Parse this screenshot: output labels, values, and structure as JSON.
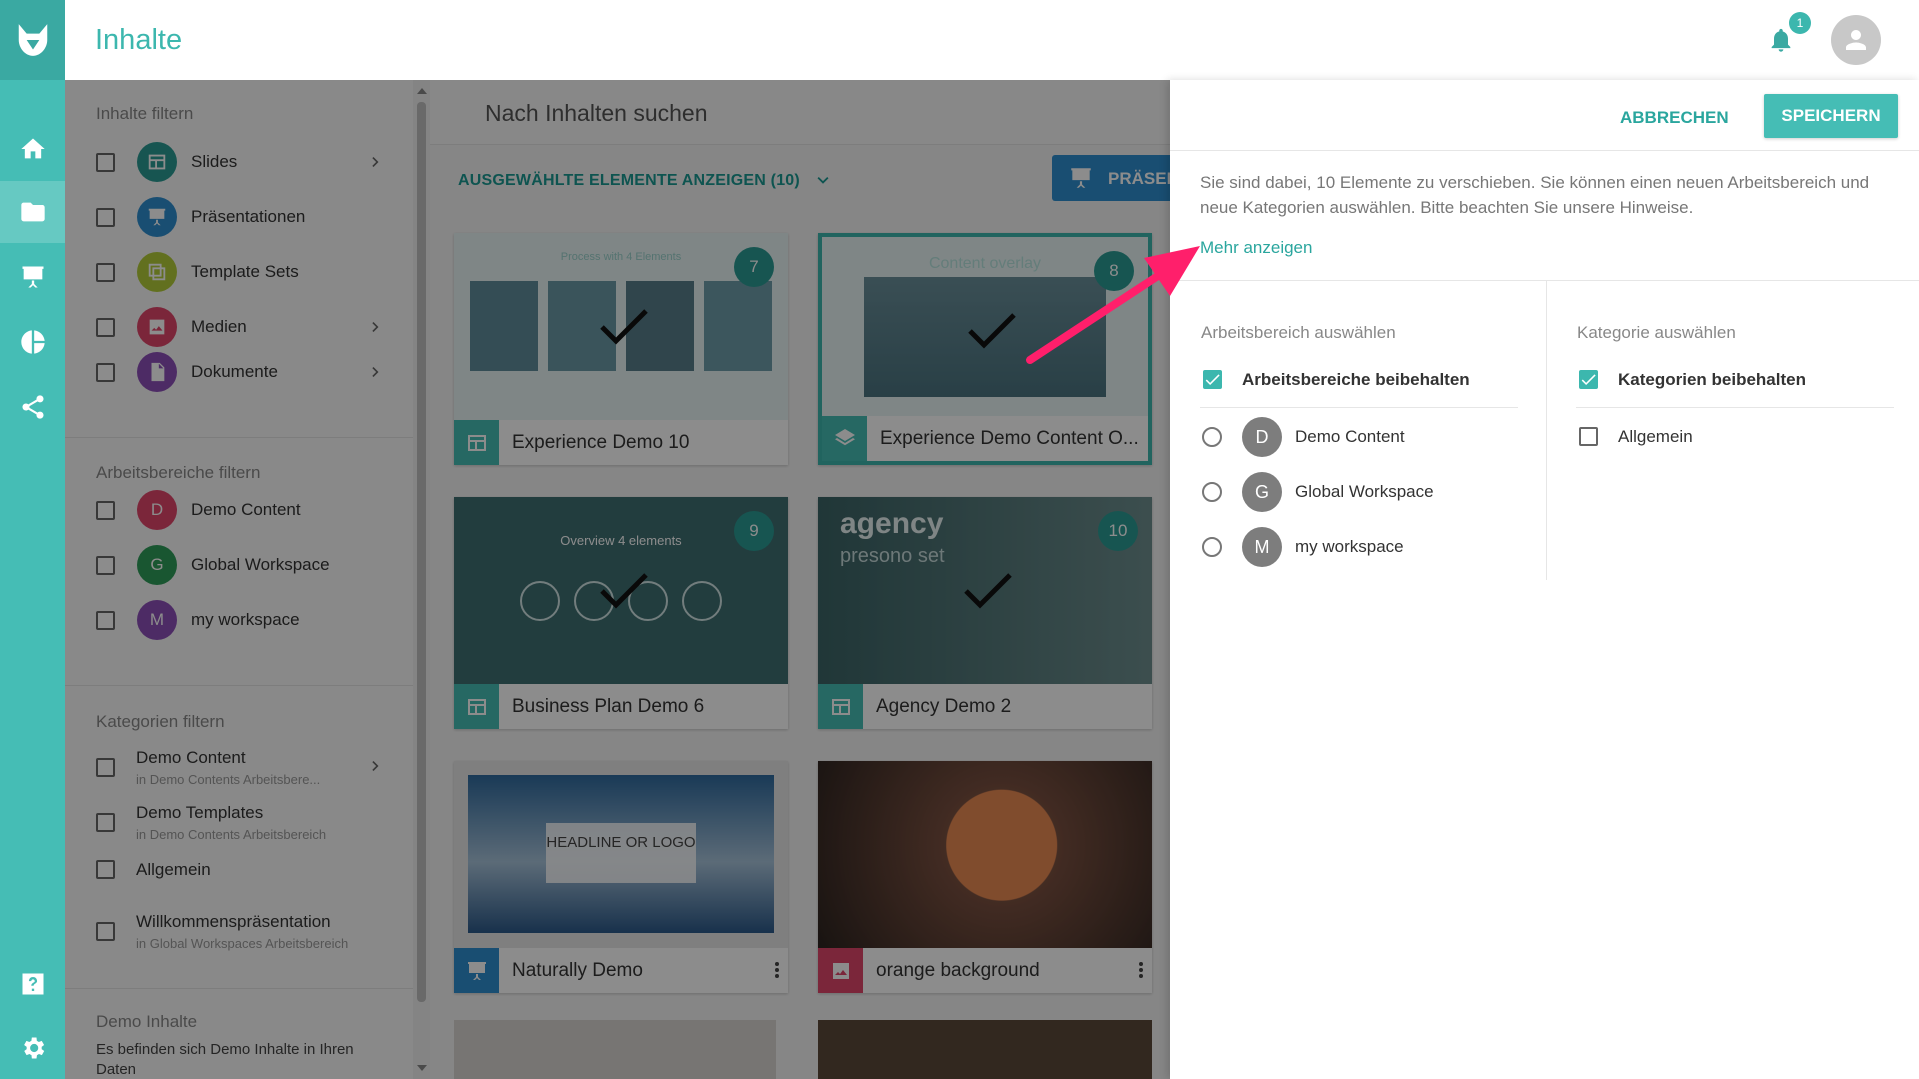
{
  "header": {
    "title": "Inhalte",
    "notification_count": "1"
  },
  "rail": {
    "items": [
      "home-icon",
      "folder-icon",
      "presentation-icon",
      "pie-chart-icon",
      "share-icon",
      "help-icon",
      "gear-icon"
    ]
  },
  "filters": {
    "content_title": "Inhalte filtern",
    "content_items": [
      {
        "label": "Slides",
        "color": "#2b9c94",
        "has_chevron": true
      },
      {
        "label": "Präsentationen",
        "color": "#2f8fd0",
        "has_chevron": false
      },
      {
        "label": "Template Sets",
        "color": "#b3cd3a",
        "has_chevron": false
      },
      {
        "label": "Medien",
        "color": "#e0466b",
        "has_chevron": true
      },
      {
        "label": "Dokumente",
        "color": "#8c4fb8",
        "has_chevron": true
      }
    ],
    "workspace_title": "Arbeitsbereiche filtern",
    "workspace_items": [
      {
        "letter": "D",
        "label": "Demo Content",
        "color": "#e0466b"
      },
      {
        "letter": "G",
        "label": "Global Workspace",
        "color": "#2f9d59"
      },
      {
        "letter": "M",
        "label": "my workspace",
        "color": "#8c4fb8"
      }
    ],
    "category_title": "Kategorien filtern",
    "category_items": [
      {
        "label": "Demo Content",
        "sub": "in Demo Contents Arbeitsbere...",
        "has_chevron": true
      },
      {
        "label": "Demo Templates",
        "sub": "in Demo Contents Arbeitsbereich",
        "has_chevron": false
      },
      {
        "label": "Allgemein",
        "sub": "",
        "has_chevron": false
      },
      {
        "label": "Willkommenspräsentation",
        "sub": "in Global Workspaces Arbeitsbereich",
        "has_chevron": false
      }
    ],
    "demo_title": "Demo Inhalte",
    "demo_text": "Es befinden sich Demo Inhalte in Ihren Daten"
  },
  "content": {
    "search_placeholder": "Nach Inhalten suchen",
    "show_selected": "AUSGEWÄHLTE ELEMENTE ANZEIGEN (10)",
    "present_label": "PRÄSEN",
    "cards": [
      {
        "name": "Experience Demo 10",
        "num": "7",
        "icon": "slide-icon",
        "thumb_text": "Process with 4 Elements",
        "selected": false
      },
      {
        "name": "Experience Demo Content O...",
        "num": "8",
        "icon": "layers-icon",
        "thumb_text": "Content overlay",
        "selected": true
      },
      {
        "name": "Business Plan Demo 6",
        "num": "9",
        "icon": "slide-icon",
        "thumb_text": "Overview 4 elements",
        "selected": false
      },
      {
        "name": "Agency Demo 2",
        "num": "10",
        "icon": "slide-icon",
        "thumb_text": "agency",
        "thumb_sub": "presono set",
        "selected": false
      },
      {
        "name": "Naturally Demo",
        "num": "",
        "icon": "presentation-icon",
        "thumb_text": "HEADLINE OR LOGO",
        "selected": false
      },
      {
        "name": "orange background",
        "num": "",
        "icon": "image-icon",
        "thumb_text": "",
        "selected": false
      }
    ]
  },
  "panel": {
    "cancel_label": "ABBRECHEN",
    "save_label": "SPEICHERN",
    "info_text": "Sie sind dabei, 10 Elemente zu verschieben. Sie können einen neuen Arbeitsbereich und neue Kategorien auswählen. Bitte beachten Sie unsere Hinweise.",
    "more_label": "Mehr anzeigen",
    "workspace_title": "Arbeitsbereich auswählen",
    "keep_workspaces": "Arbeitsbereiche beibehalten",
    "workspaces": [
      {
        "letter": "D",
        "label": "Demo Content"
      },
      {
        "letter": "G",
        "label": "Global Workspace"
      },
      {
        "letter": "M",
        "label": "my workspace"
      }
    ],
    "category_title": "Kategorie auswählen",
    "keep_categories": "Kategorien beibehalten",
    "categories": [
      {
        "label": "Allgemein"
      }
    ]
  },
  "colors": {
    "accent": "#45bdb5",
    "accent_dark": "#2aa69e",
    "arrow": "#ff1f6b"
  }
}
